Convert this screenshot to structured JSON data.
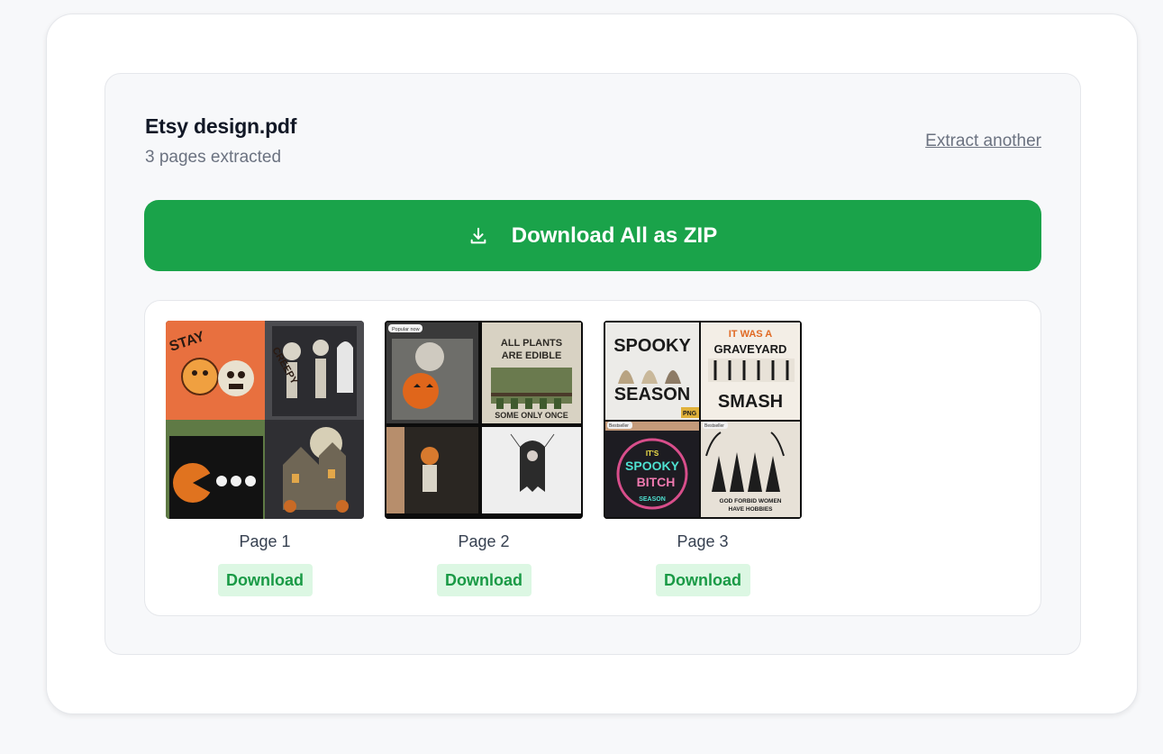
{
  "file": {
    "name": "Etsy design.pdf",
    "subtitle": "3 pages extracted",
    "extract_another_label": "Extract another"
  },
  "zip_button": {
    "label": "Download All as ZIP",
    "icon": "download-icon",
    "color": "#1aa34a"
  },
  "pages": [
    {
      "label": "Page 1",
      "download_label": "Download",
      "thumb_text": {
        "tl": "STAY",
        "tr": "CREEPY"
      }
    },
    {
      "label": "Page 2",
      "download_label": "Download",
      "thumb_text": {
        "badge": "Popular now",
        "tr_line1": "ALL PLANTS",
        "tr_line2": "ARE EDIBLE",
        "tr_line3": "SOME ONLY ONCE"
      }
    },
    {
      "label": "Page 3",
      "download_label": "Download",
      "thumb_text": {
        "tl_line1": "SPOOKY",
        "tl_line2": "SEASON",
        "tl_png": "PNG",
        "tr_line1": "IT WAS A",
        "tr_line2": "GRAVEYARD",
        "tr_line3": "SMASH",
        "bl_badge": "Bestseller",
        "bl_line1": "IT'S",
        "bl_line2": "SPOOKY",
        "bl_line3": "BITCH",
        "bl_line4": "SEASON",
        "br_badge": "Bestseller",
        "br_line1": "GOD FORBID WOMEN",
        "br_line2": "HAVE HOBBIES"
      }
    }
  ],
  "colors": {
    "accent": "#1aa34a",
    "download_bg": "#dcf7e3",
    "download_text": "#1a9a46"
  }
}
